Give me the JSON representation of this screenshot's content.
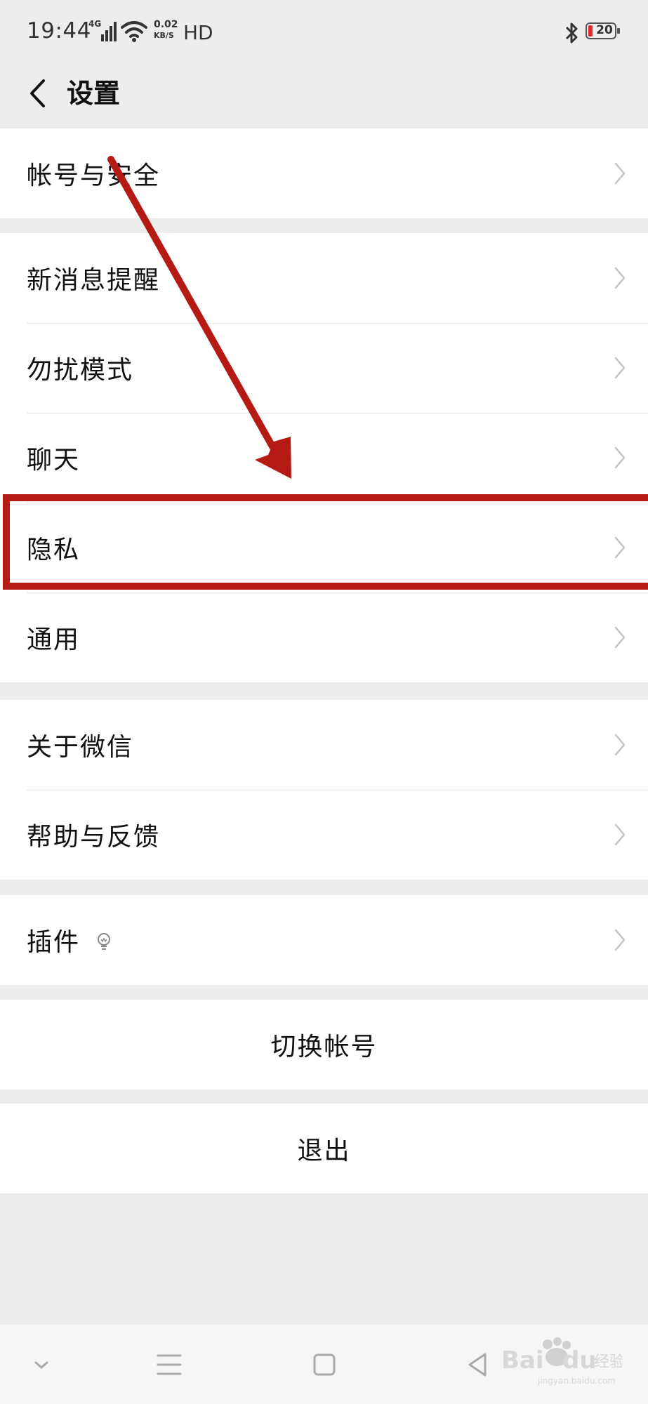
{
  "status_bar": {
    "time": "19:44",
    "network": "4G",
    "speed_value": "0.02",
    "speed_unit": "KB/S",
    "hd": "HD",
    "battery": "20"
  },
  "header": {
    "title": "设置"
  },
  "groups": {
    "account": [
      "帐号与安全"
    ],
    "settings": [
      "新消息提醒",
      "勿扰模式",
      "聊天",
      "隐私",
      "通用"
    ],
    "about": [
      "关于微信",
      "帮助与反馈"
    ],
    "plugins": [
      "插件"
    ],
    "switch_account": "切换帐号",
    "logout": "退出"
  },
  "colors": {
    "annotation_red": "#b51a14",
    "background": "#ededed",
    "card": "#ffffff"
  },
  "icons": {
    "back": "chevron-left-icon",
    "row": "chevron-right-icon",
    "plugin": "lightbulb-icon"
  },
  "watermark": {
    "text": "Baidu经验",
    "sub": "jingyan.baidu.com"
  }
}
